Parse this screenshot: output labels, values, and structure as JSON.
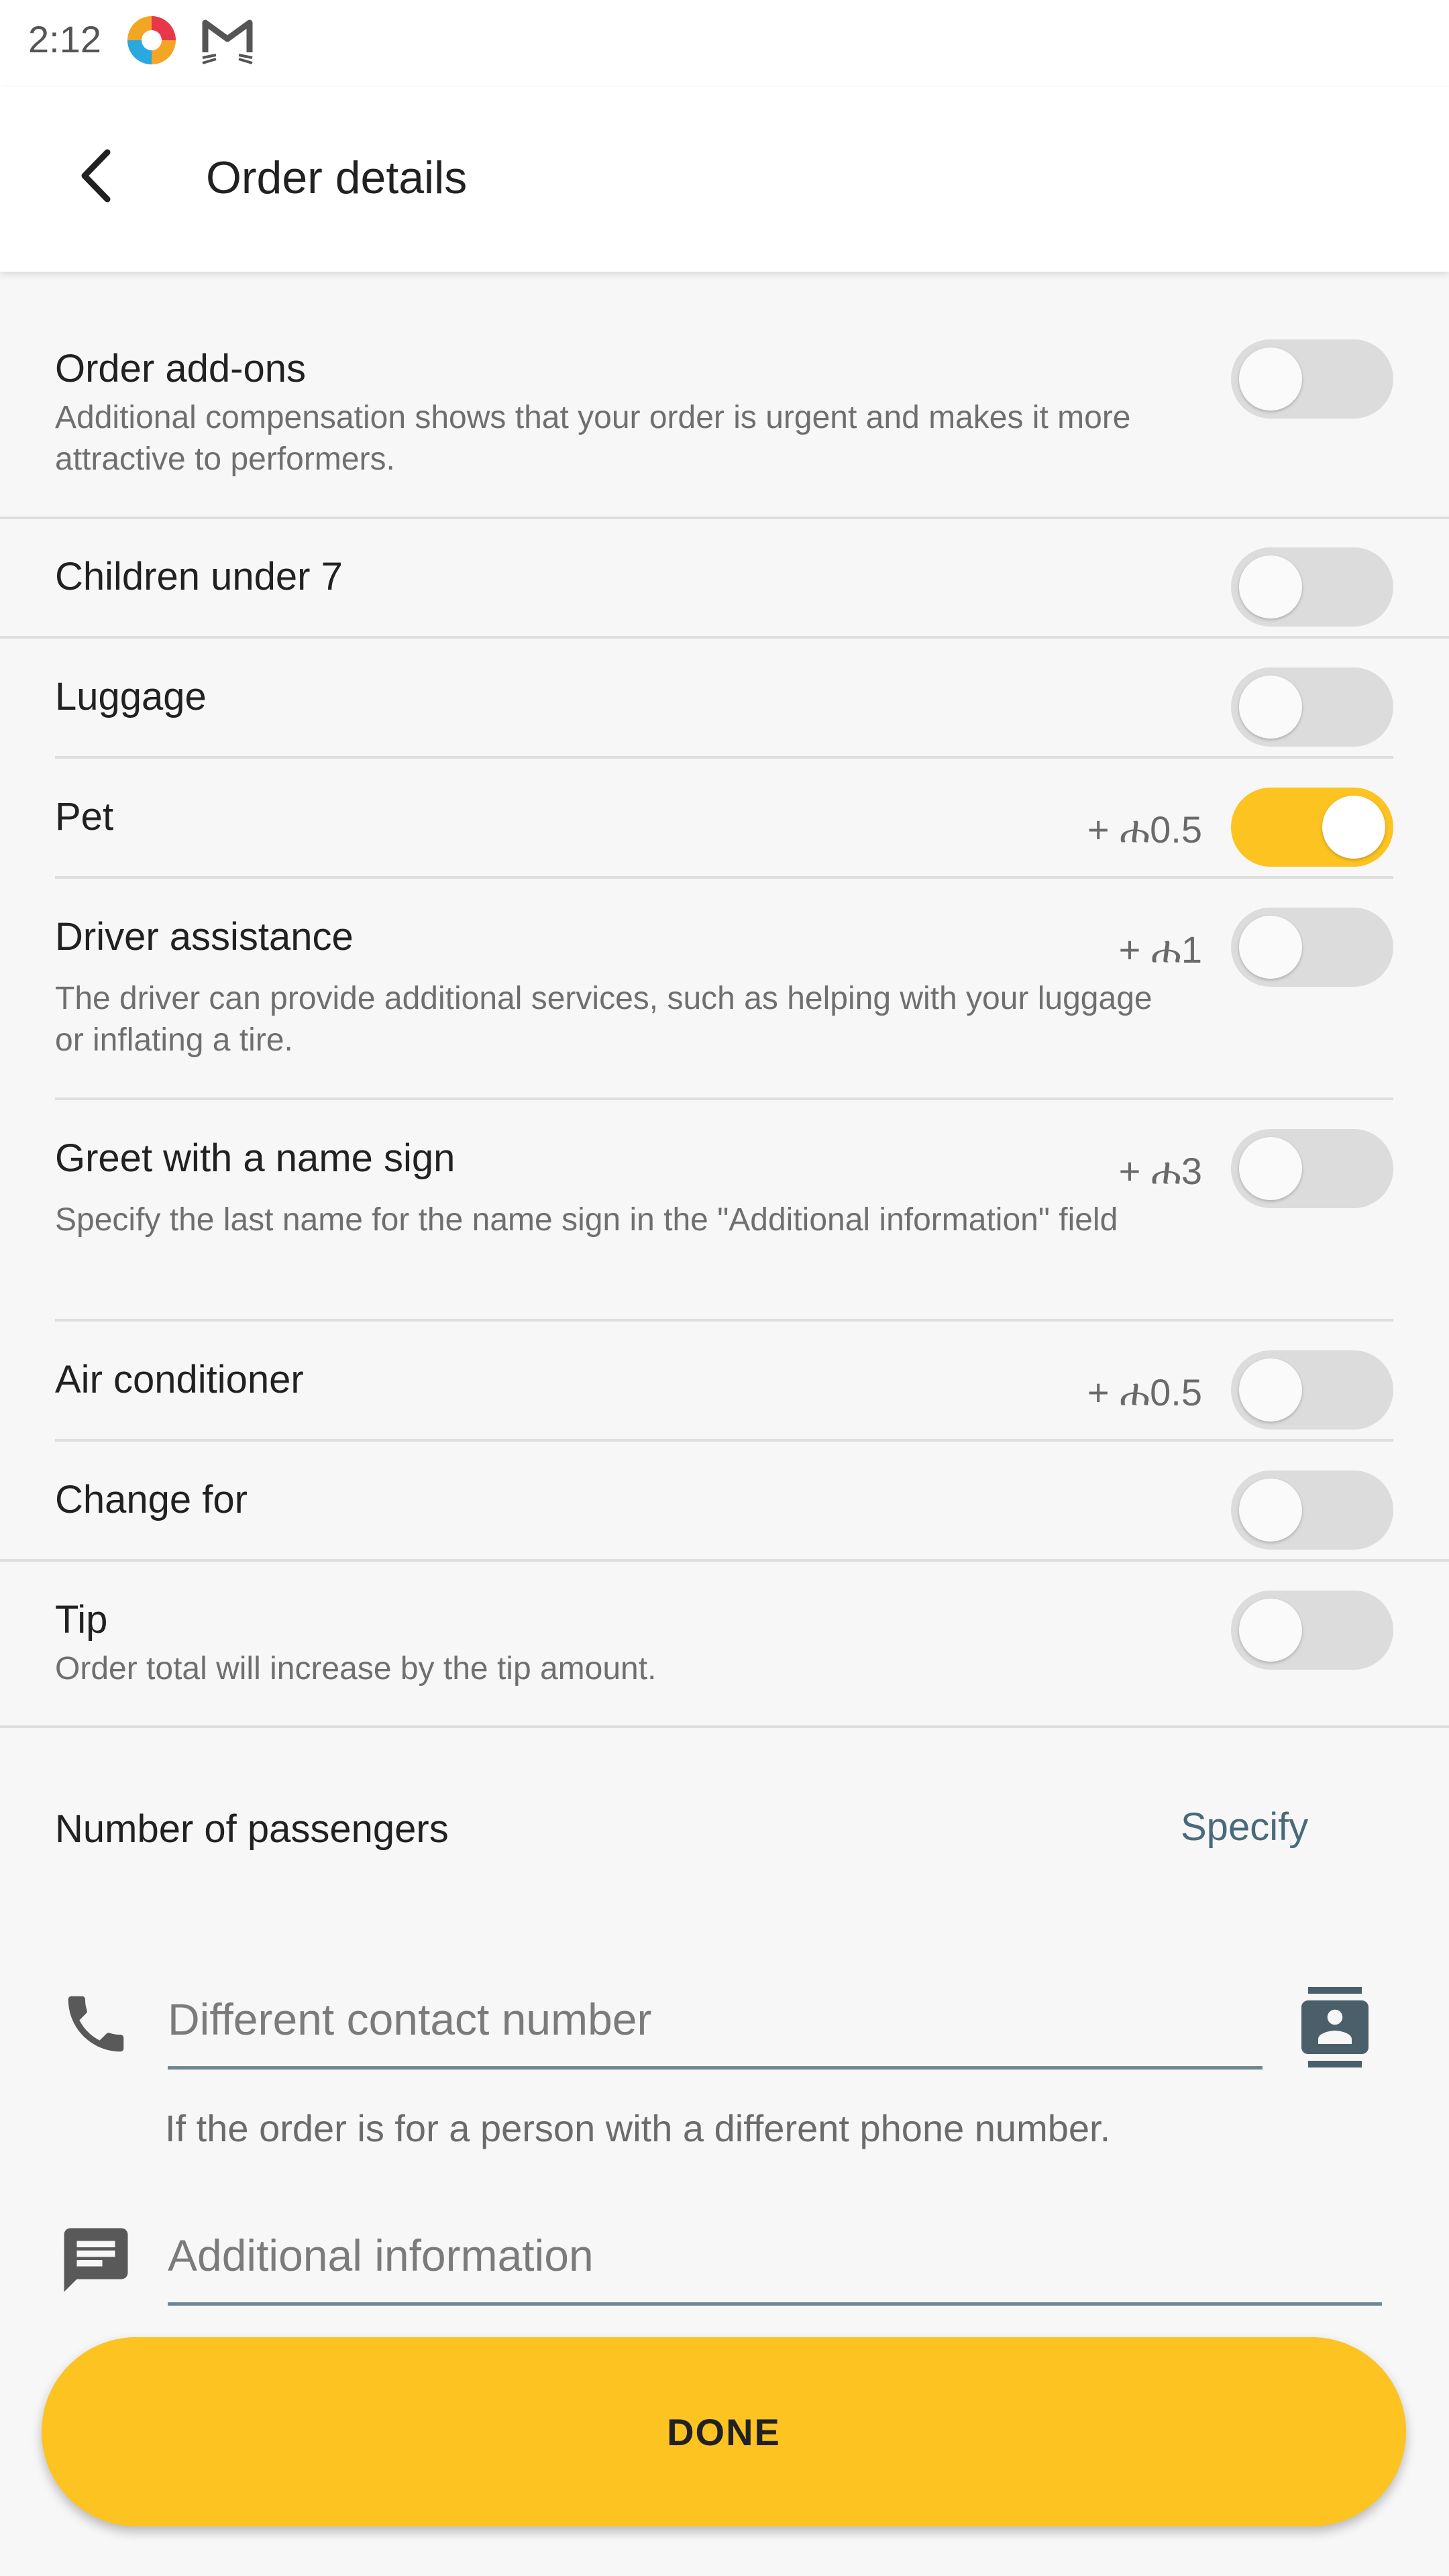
{
  "status_bar": {
    "time": "2:12"
  },
  "app_bar": {
    "title": "Order details"
  },
  "addons": {
    "title": "Order add-ons",
    "description": "Additional compensation shows that your order is urgent and makes it more attractive to performers.",
    "enabled": false
  },
  "options": [
    {
      "title": "Children under 7",
      "price": "",
      "description": "",
      "enabled": false
    },
    {
      "title": "Luggage",
      "price": "",
      "description": "",
      "enabled": false
    },
    {
      "title": "Pet",
      "price": "+ ሐ0.5",
      "description": "",
      "enabled": true
    },
    {
      "title": "Driver assistance",
      "price": "+ ሐ1",
      "description": "The driver can provide additional services, such as helping with your luggage or inflating a tire.",
      "enabled": false
    },
    {
      "title": "Greet with a name sign",
      "price": "+ ሐ3",
      "description": "Specify the last name for the name sign in the \"Additional information\" field",
      "enabled": false
    },
    {
      "title": "Air conditioner",
      "price": "+ ሐ0.5",
      "description": "",
      "enabled": false
    },
    {
      "title": "Change for",
      "price": "",
      "description": "",
      "enabled": false
    }
  ],
  "tip": {
    "title": "Tip",
    "description": "Order total will increase by the tip amount.",
    "enabled": false
  },
  "passengers": {
    "label": "Number of passengers",
    "action": "Specify"
  },
  "contact": {
    "value": "",
    "placeholder": "Different contact number",
    "helper": "If the order is for a person with a different phone number."
  },
  "additional_info": {
    "value": "",
    "placeholder": "Additional information"
  },
  "done_button": {
    "label": "DONE"
  },
  "colors": {
    "accent": "#fcc321",
    "toggle_off": "#dcdcdc",
    "link": "#4a6a7c"
  }
}
